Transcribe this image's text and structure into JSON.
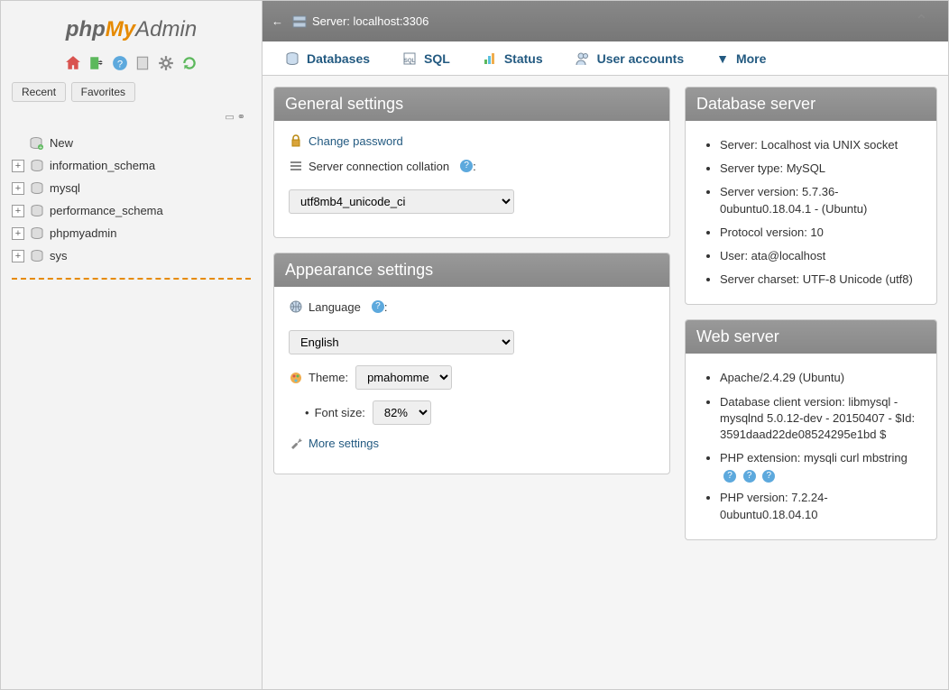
{
  "logo": {
    "part1": "php",
    "part2": "My",
    "part3": "Admin"
  },
  "sidebar": {
    "recentTab": "Recent",
    "favoritesTab": "Favorites",
    "newLabel": "New",
    "databases": [
      "information_schema",
      "mysql",
      "performance_schema",
      "phpmyadmin",
      "sys"
    ]
  },
  "topbar": {
    "breadcrumb": "Server: localhost:3306"
  },
  "navTabs": {
    "databases": "Databases",
    "sql": "SQL",
    "status": "Status",
    "userAccounts": "User accounts",
    "more": "More"
  },
  "general": {
    "title": "General settings",
    "changePassword": "Change password",
    "collationLabel": "Server connection collation",
    "collationValue": "utf8mb4_unicode_ci"
  },
  "appearance": {
    "title": "Appearance settings",
    "languageLabel": "Language",
    "languageValue": "English",
    "themeLabel": "Theme:",
    "themeValue": "pmahomme",
    "fontSizeLabel": "Font size:",
    "fontSizeValue": "82%",
    "moreSettings": "More settings"
  },
  "dbserver": {
    "title": "Database server",
    "items": [
      "Server: Localhost via UNIX socket",
      "Server type: MySQL",
      "Server version: 5.7.36-0ubuntu0.18.04.1 - (Ubuntu)",
      "Protocol version: 10",
      "User: ata@localhost",
      "Server charset: UTF-8 Unicode (utf8)"
    ]
  },
  "webserver": {
    "title": "Web server",
    "items": [
      "Apache/2.4.29 (Ubuntu)",
      "Database client version: libmysql - mysqlnd 5.0.12-dev - 20150407 - $Id: 3591daad22de08524295e1bd $",
      "PHP extension: mysqli curl mbstring",
      "PHP version: 7.2.24-0ubuntu0.18.04.10"
    ]
  }
}
